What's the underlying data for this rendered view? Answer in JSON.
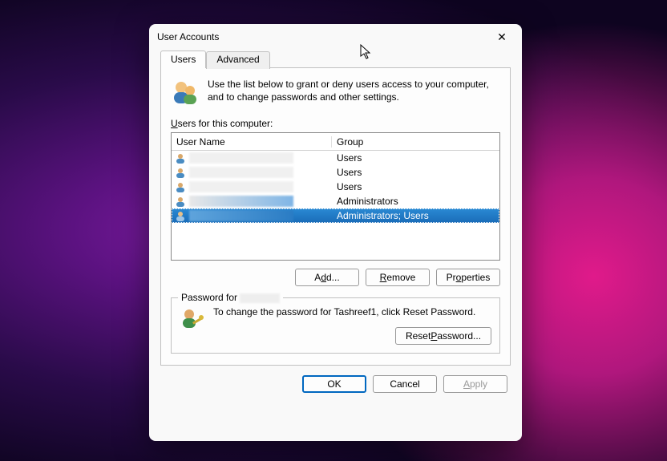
{
  "window": {
    "title": "User Accounts",
    "close_icon": "✕"
  },
  "tabs": {
    "users": "Users",
    "advanced": "Advanced"
  },
  "intro": "Use the list below to grant or deny users access to your computer, and to change passwords and other settings.",
  "users_label_prefix": "U",
  "users_label_rest": "sers for this computer:",
  "columns": {
    "username": "User Name",
    "group": "Group"
  },
  "rows": [
    {
      "group": "Users",
      "selected": false
    },
    {
      "group": "Users",
      "selected": false
    },
    {
      "group": "Users",
      "selected": false
    },
    {
      "group": "Administrators",
      "selected": false
    },
    {
      "group": "Administrators; Users",
      "selected": true
    }
  ],
  "buttons": {
    "add": "Add...",
    "remove": "Remove",
    "properties": "Properties",
    "reset_password": "Reset Password...",
    "ok": "OK",
    "cancel": "Cancel",
    "apply": "Apply"
  },
  "underlines": {
    "add": "d",
    "remove": "R",
    "properties": "o",
    "reset_password": "P",
    "apply": "A"
  },
  "password_section": {
    "legend_prefix": "Password for ",
    "text": "To change the password for Tashreef1, click Reset Password."
  }
}
